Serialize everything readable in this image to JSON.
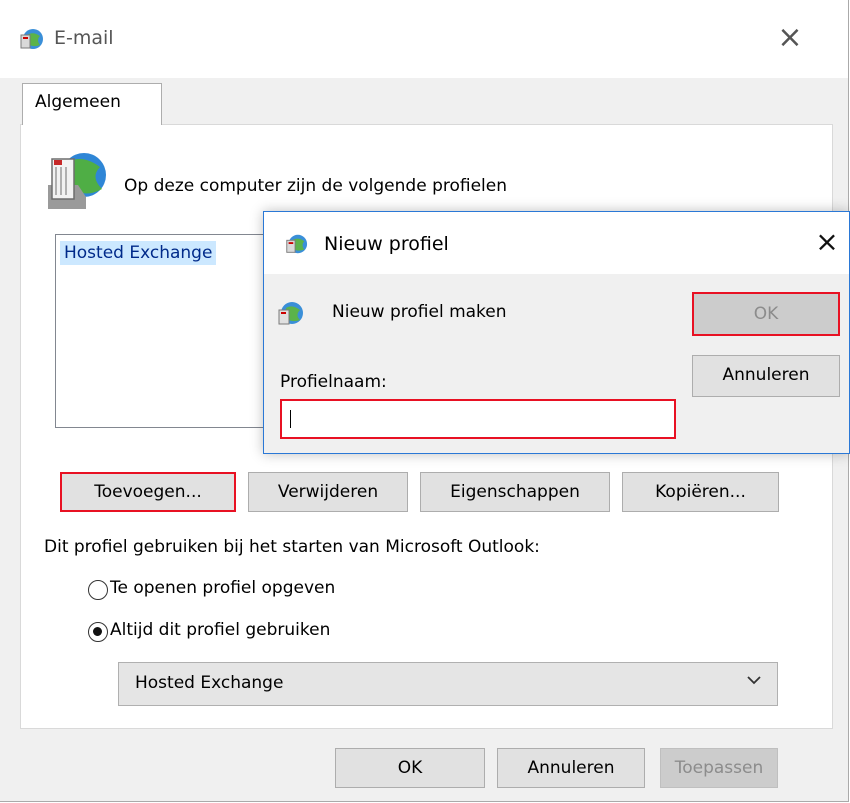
{
  "main_window": {
    "title": "E-mail",
    "close_glyph": "×",
    "tab_label": "Algemeen",
    "heading": "Op deze computer zijn de volgende profielen",
    "profiles": [
      "Hosted Exchange"
    ],
    "buttons": {
      "add": "Toevoegen...",
      "remove": "Verwijderen",
      "properties": "Eigenschappen",
      "copy": "Kopiëren..."
    },
    "startup_label": "Dit profiel gebruiken bij het starten van Microsoft Outlook:",
    "radio_options": [
      {
        "label": "Te openen profiel opgeven",
        "selected": false
      },
      {
        "label": "Altijd dit profiel gebruiken",
        "selected": true
      }
    ],
    "selected_profile": "Hosted Exchange",
    "footer_buttons": {
      "ok": "OK",
      "cancel": "Annuleren",
      "apply": "Toepassen"
    }
  },
  "new_profile_dialog": {
    "title": "Nieuw profiel",
    "close_glyph": "×",
    "message": "Nieuw profiel maken",
    "ok": "OK",
    "cancel": "Annuleren",
    "field_label": "Profielnaam:",
    "field_value": ""
  },
  "colors": {
    "highlight_border": "#e81123",
    "selection_bg": "#cce8ff",
    "dialog_border": "#2a78d6"
  },
  "icons": {
    "window_icon": "mail-profile-icon",
    "profiles_icon": "mail-server-icon",
    "dropdown": "chevron-down-icon"
  }
}
